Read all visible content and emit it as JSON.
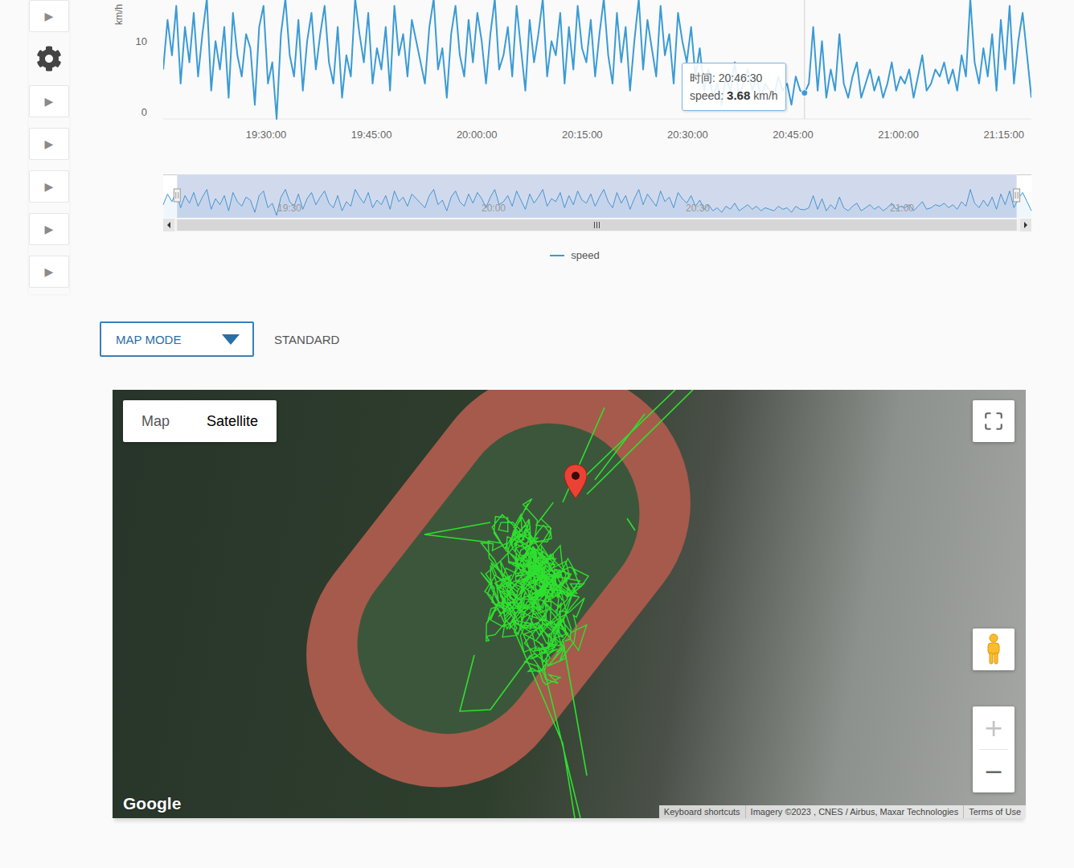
{
  "sidebar": {
    "items": [
      {
        "kind": "button",
        "label": "▶"
      },
      {
        "kind": "settings"
      },
      {
        "kind": "button",
        "label": "▶"
      },
      {
        "kind": "button",
        "label": "▶"
      },
      {
        "kind": "button",
        "label": "▶"
      },
      {
        "kind": "button",
        "label": "▶"
      },
      {
        "kind": "button",
        "label": "▶"
      }
    ]
  },
  "chart": {
    "y_axis": {
      "title": "km/h",
      "ticks": [
        {
          "label": "10",
          "value": 10
        },
        {
          "label": "0",
          "value": 0
        }
      ]
    },
    "x_axis": {
      "ticks": [
        "19:30:00",
        "19:45:00",
        "20:00:00",
        "20:15:00",
        "20:30:00",
        "20:45:00",
        "21:00:00",
        "21:15:00"
      ]
    },
    "series": [
      {
        "name": "speed",
        "values": [
          7,
          14,
          9,
          16,
          5,
          13,
          8,
          15,
          6,
          12,
          17,
          4,
          11,
          7,
          13,
          3,
          15,
          9,
          6,
          12,
          10,
          2,
          13,
          16,
          5,
          8,
          0,
          12,
          17,
          9,
          6,
          14,
          4,
          11,
          15,
          7,
          12,
          16,
          8,
          5,
          13,
          3,
          9,
          6,
          17,
          12,
          8,
          15,
          5,
          10,
          7,
          13,
          4,
          16,
          9,
          12,
          6,
          14,
          11,
          8,
          5,
          13,
          17,
          7,
          10,
          3,
          12,
          16,
          9,
          6,
          14,
          8,
          15,
          11,
          5,
          12,
          17,
          7,
          9,
          13,
          6,
          16,
          10,
          4,
          14,
          8,
          12,
          17,
          6,
          11,
          9,
          15,
          5,
          13,
          7,
          16,
          10,
          8,
          14,
          6,
          12,
          17,
          9,
          5,
          15,
          8,
          13,
          4,
          11,
          17,
          7,
          14,
          10,
          6,
          16,
          9,
          12,
          5,
          15,
          11,
          8,
          13,
          6,
          10,
          4,
          7,
          3,
          5,
          2,
          6,
          4,
          8,
          3,
          5,
          7,
          4,
          6,
          3,
          5,
          4,
          3,
          6,
          4,
          5,
          2,
          6,
          4,
          3.68,
          5,
          13,
          4,
          11,
          3,
          7,
          4,
          12,
          5,
          3,
          6,
          8,
          3,
          5,
          7,
          4,
          6,
          3,
          5,
          8,
          4,
          6,
          5,
          7,
          3,
          6,
          9,
          4,
          5,
          7,
          6,
          8,
          5,
          7,
          4,
          9,
          6,
          17,
          8,
          5,
          10,
          6,
          12,
          4,
          14,
          7,
          16,
          5,
          11,
          15,
          9,
          3
        ]
      }
    ],
    "tooltip": {
      "time": "时间: 20:46:30",
      "label": "speed:",
      "value": "3.68",
      "unit": "km/h",
      "hover_index": 147
    },
    "navigator": {
      "labels": [
        "19:30",
        "20:00",
        "20:30",
        "21:00"
      ],
      "range_start": 0.016,
      "range_end": 0.983
    },
    "legend": [
      {
        "label": "speed"
      }
    ]
  },
  "map_mode": {
    "label": "MAP MODE",
    "value": "STANDARD"
  },
  "map": {
    "types": [
      {
        "label": "Map",
        "selected": false
      },
      {
        "label": "Satellite",
        "selected": true
      }
    ],
    "zoom": [
      {
        "label": "+",
        "disabled": true
      },
      {
        "label": "−",
        "disabled": false
      }
    ],
    "logo": "Google",
    "attribution": [
      "Keyboard shortcuts",
      "Imagery ©2023 , CNES / Airbus, Maxar Technologies",
      "Terms of Use"
    ]
  }
}
